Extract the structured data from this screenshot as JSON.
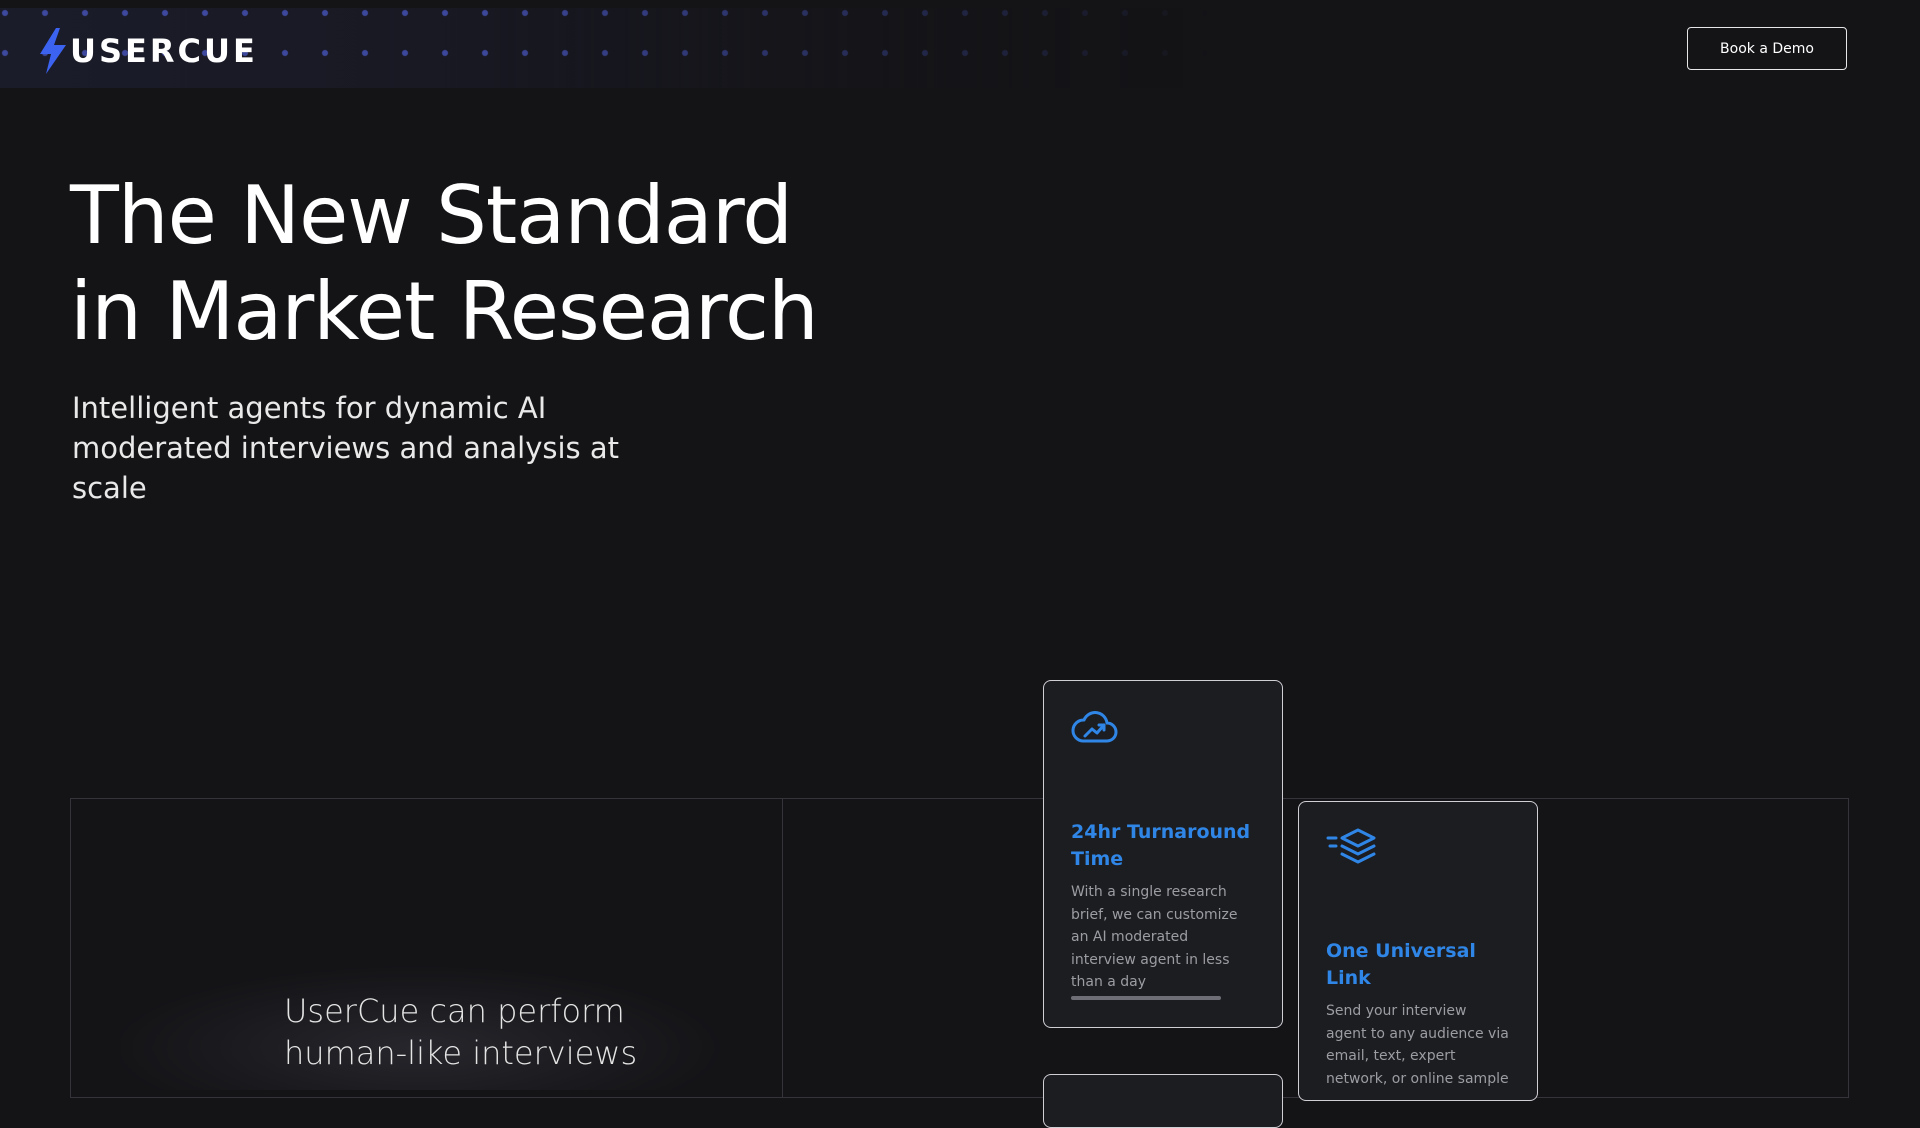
{
  "header": {
    "logo_text": "USERCUE",
    "logo_icon": "lightning-bolt-icon",
    "cta_label": "Book a Demo"
  },
  "hero": {
    "title_line1": "The New Standard",
    "title_line2": "in Market Research",
    "subtitle": "Intelligent agents for dynamic AI moderated interviews and analysis at scale"
  },
  "section": {
    "tagline": "UserCue can perform human-like interviews"
  },
  "features": [
    {
      "icon": "cloud-trend-icon",
      "title": "24hr Turnaround Time",
      "description": "With a single research brief, we can customize an AI moderated interview agent in less than a day",
      "progress": 1.0
    },
    {
      "icon": "stacked-layers-icon",
      "title": "One Universal Link",
      "description": "Send your interview agent to any audience via email, text, expert network, or online sample"
    }
  ],
  "colors": {
    "background": "#141417",
    "accent": "#2f86e6",
    "logo_bolt": "#3b63f0",
    "card_bg": "#1c1d21"
  }
}
